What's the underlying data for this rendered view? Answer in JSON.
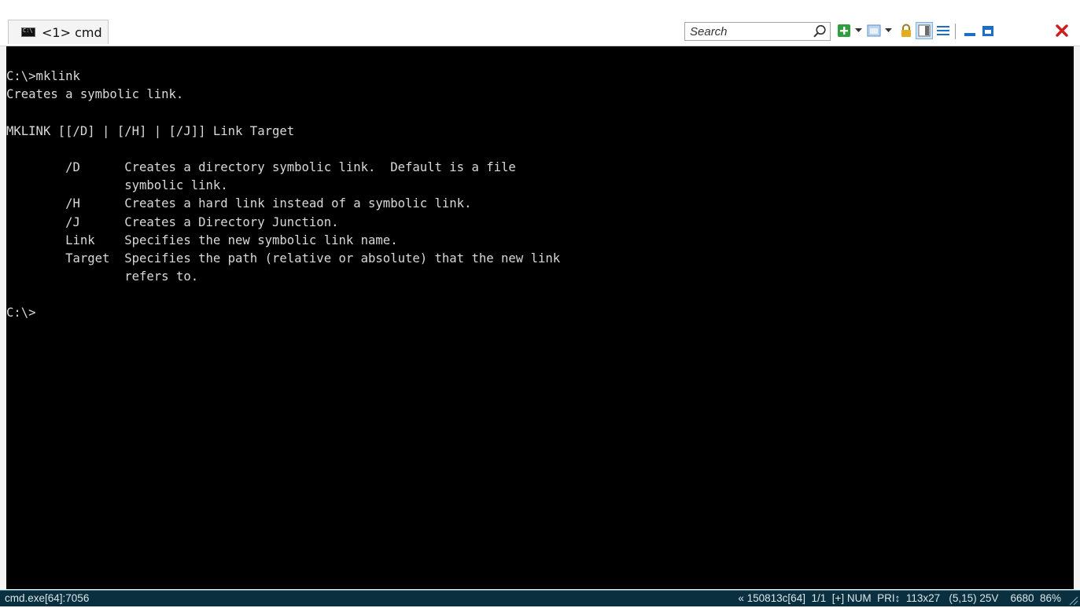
{
  "window": {
    "tab_title": "<1> cmd",
    "search_placeholder": "Search"
  },
  "toolbar": {
    "icons": [
      "search-icon",
      "new-console-icon",
      "dropdown-icon",
      "split-icon",
      "dropdown-icon",
      "lock-icon",
      "panels-icon",
      "menu-icon",
      "minimize-icon",
      "maximize-icon",
      "close-icon"
    ],
    "colors": {
      "new": "#2e9e3e",
      "close": "#d11a1a",
      "accent": "#1c6ec7",
      "lock": "#d9a21b"
    }
  },
  "terminal": {
    "lines": [
      "C:\\>mklink",
      "Creates a symbolic link.",
      "",
      "MKLINK [[/D] | [/H] | [/J]] Link Target",
      "",
      "        /D      Creates a directory symbolic link.  Default is a file",
      "                symbolic link.",
      "        /H      Creates a hard link instead of a symbolic link.",
      "        /J      Creates a Directory Junction.",
      "        Link    Specifies the new symbolic link name.",
      "        Target  Specifies the path (relative or absolute) that the new link",
      "                refers to.",
      "",
      "C:\\>"
    ],
    "background": "#000000",
    "foreground": "#d9d9d9"
  },
  "statusbar": {
    "process": "cmd.exe[64]:7056",
    "info": "« 150813c[64]  1/1  [+] NUM  PRI↕  113x27   (5,15) 25V    6680  86%"
  }
}
